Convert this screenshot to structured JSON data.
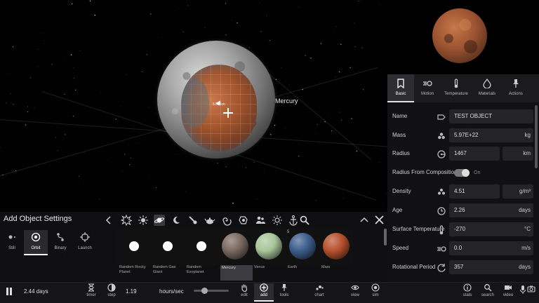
{
  "scene": {
    "planet_label": "Mercury",
    "size_readout": "6.33 km"
  },
  "properties": {
    "tabs": [
      {
        "label": "Basic",
        "icon": "bookmark-icon",
        "active": true
      },
      {
        "label": "Motion",
        "icon": "motion-icon",
        "active": false
      },
      {
        "label": "Temperature",
        "icon": "thermometer-icon",
        "active": false
      },
      {
        "label": "Materials",
        "icon": "materials-icon",
        "active": false
      },
      {
        "label": "Actions",
        "icon": "actions-icon",
        "active": false
      }
    ],
    "name": {
      "label": "Name",
      "value": "TEST OBJECT"
    },
    "mass": {
      "label": "Mass",
      "value": "5.97E+22",
      "unit": "kg"
    },
    "radius": {
      "label": "Radius",
      "value": "1467",
      "unit": "km"
    },
    "radius_from_composition": {
      "label": "Radius From Composition",
      "state": "On"
    },
    "density": {
      "label": "Density",
      "value": "4.51",
      "unit": "g/m³"
    },
    "age": {
      "label": "Age",
      "value": "2.26",
      "unit": "days"
    },
    "surface_temperature": {
      "label": "Surface Temperature",
      "value": "-270",
      "unit": "°C"
    },
    "speed": {
      "label": "Speed",
      "value": "0.0",
      "unit": "m/s"
    },
    "rotational_period": {
      "label": "Rotational Period",
      "value": "357",
      "unit": "days"
    }
  },
  "add_panel": {
    "title": "Add Object Settings",
    "modes": [
      {
        "label": "Still",
        "active": false
      },
      {
        "label": "Orbit",
        "active": true
      },
      {
        "label": "Binary",
        "active": false
      },
      {
        "label": "Launch",
        "active": false
      }
    ],
    "count_badge": "5",
    "objects": [
      {
        "label": "Random Rocky Planet",
        "color": "#ffffff",
        "selected": false
      },
      {
        "label": "Random Gas Giant",
        "color": "#ffffff",
        "selected": false
      },
      {
        "label": "Random Exoplanet",
        "color": "#ffffff",
        "selected": false
      },
      {
        "label": "Mercury",
        "color": "#7a6a60",
        "selected": true
      },
      {
        "label": "Venus",
        "color": "#a8c69a",
        "selected": false
      },
      {
        "label": "Earth",
        "color": "#3d5e8c",
        "selected": false
      },
      {
        "label": "Mars",
        "color": "#b8512e",
        "selected": false
      }
    ]
  },
  "toolbar": {
    "elapsed": "2.44 days",
    "speed_value": "1.19",
    "speed_unit": "hours/sec",
    "speed_level": 0.3,
    "buttons": [
      {
        "label": "timer",
        "icon": "hourglass-icon"
      },
      {
        "label": "step",
        "icon": "step-icon"
      },
      {
        "label": "edit",
        "icon": "hand-icon"
      },
      {
        "label": "add",
        "icon": "add-icon",
        "active": true
      },
      {
        "label": "tools",
        "icon": "tools-icon"
      },
      {
        "label": "chart",
        "icon": "chart-icon"
      },
      {
        "label": "view",
        "icon": "eye-icon"
      },
      {
        "label": "sim",
        "icon": "sim-icon"
      },
      {
        "label": "stats",
        "icon": "info-icon"
      },
      {
        "label": "search",
        "icon": "search-icon"
      },
      {
        "label": "video",
        "icon": "video-icon"
      }
    ]
  }
}
